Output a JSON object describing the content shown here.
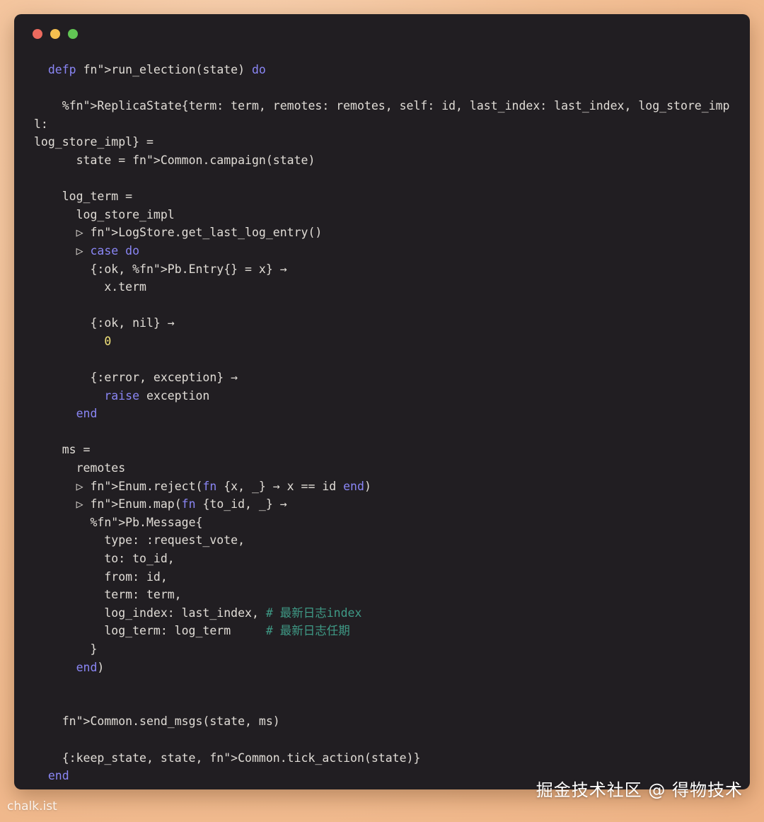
{
  "window": {
    "traffic_lights": [
      {
        "name": "close",
        "color": "#ec6a5e"
      },
      {
        "name": "minimize",
        "color": "#f4bf4f"
      },
      {
        "name": "zoom",
        "color": "#61c554"
      }
    ]
  },
  "syntax_colors": {
    "keyword": "#8a86f5",
    "function": "#58c7a8",
    "number": "#f2e37a",
    "comment": "#3f9a86",
    "text": "#e0dcd6",
    "background": "#211e22"
  },
  "code": {
    "lines": [
      "  defp run_election(state) do",
      "",
      "    %ReplicaState{term: term, remotes: remotes, self: id, last_index: last_index, log_store_impl:",
      "log_store_impl} =",
      "      state = Common.campaign(state)",
      "",
      "    log_term =",
      "      log_store_impl",
      "      ▷ LogStore.get_last_log_entry()",
      "      ▷ case do",
      "        {:ok, %Pb.Entry{} = x} →",
      "          x.term",
      "",
      "        {:ok, nil} →",
      "          0",
      "",
      "        {:error, exception} →",
      "          raise exception",
      "      end",
      "",
      "    ms =",
      "      remotes",
      "      ▷ Enum.reject(fn {x, _} → x == id end)",
      "      ▷ Enum.map(fn {to_id, _} →",
      "        %Pb.Message{",
      "          type: :request_vote,",
      "          to: to_id,",
      "          from: id,",
      "          term: term,",
      "          log_index: last_index, # 最新日志index",
      "          log_term: log_term     # 最新日志任期",
      "        }",
      "      end)",
      "",
      "",
      "    Common.send_msgs(state, ms)",
      "",
      "    {:keep_state, state, Common.tick_action(state)}",
      "  end"
    ]
  },
  "watermark": "掘金技术社区 @ 得物技术",
  "chalk_label": "chalk.ist"
}
